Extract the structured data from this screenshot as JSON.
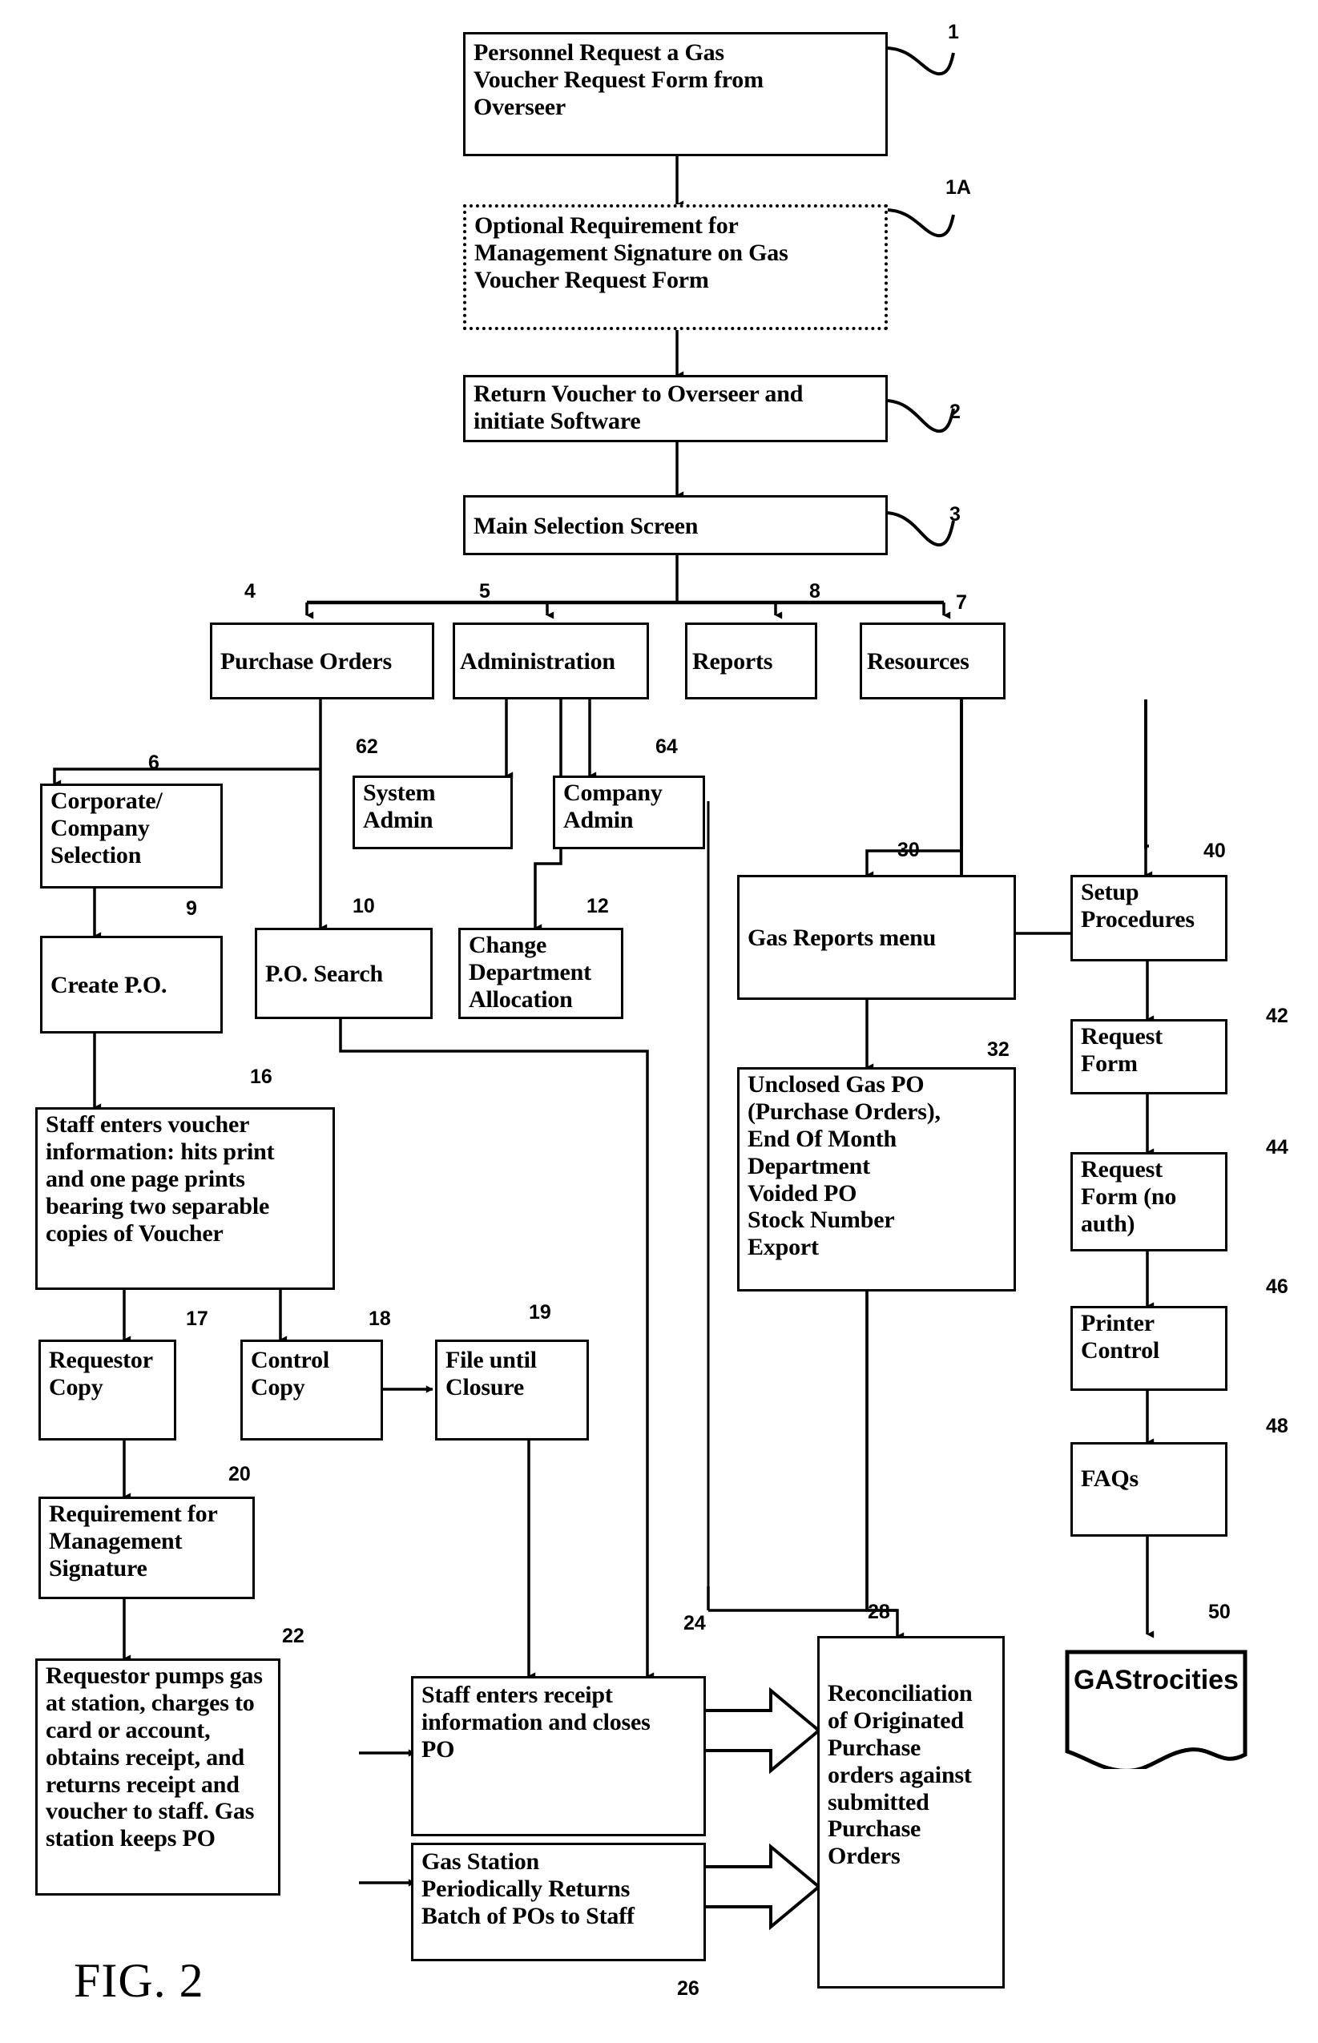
{
  "figure": {
    "label": "FIG. 2",
    "title": "Gas Voucher Purchase Order Process Flowchart"
  },
  "nodes": {
    "personnel_request": {
      "text": "Personnel Request a Gas\nVoucher Request Form from\nOverseer",
      "ref": "1"
    },
    "optional_signature": {
      "text": "Optional Requirement for\nManagement Signature on Gas\nVoucher Request Form",
      "ref": "1A"
    },
    "return_voucher": {
      "text": "Return Voucher to Overseer and\ninitiate Software",
      "ref": "2"
    },
    "main_selection": {
      "text": "Main Selection Screen",
      "ref": "3"
    },
    "purchase_orders": {
      "text": "Purchase Orders",
      "ref": "4"
    },
    "administration": {
      "text": "Administration",
      "ref": "5"
    },
    "reports": {
      "text": "Reports",
      "ref": "8"
    },
    "resources": {
      "text": "Resources",
      "ref": "7"
    },
    "system_admin": {
      "text": "System\nAdmin",
      "ref": "62"
    },
    "company_admin": {
      "text": "Company\nAdmin",
      "ref": "64"
    },
    "corporate_selection": {
      "text": "Corporate/\nCompany\nSelection",
      "ref": "6"
    },
    "create_po": {
      "text": "Create P.O.",
      "ref": "9"
    },
    "po_search": {
      "text": "P.O. Search",
      "ref": "10"
    },
    "change_dept": {
      "text": "Change\nDepartment\nAllocation",
      "ref": "12"
    },
    "gas_reports_menu": {
      "text": "Gas Reports menu",
      "ref": "30"
    },
    "unclosed_gas_po": {
      "text": "Unclosed Gas PO\n(Purchase Orders),\nEnd Of Month\nDepartment\nVoided PO\nStock Number\nExport",
      "ref": "32"
    },
    "setup_procedures": {
      "text": "Setup\nProcedures",
      "ref": "40"
    },
    "request_form": {
      "text": "Request\nForm",
      "ref": "42"
    },
    "request_form_noauth": {
      "text": "Request\nForm (no\nauth)",
      "ref": "44"
    },
    "printer_control": {
      "text": "Printer\nControl",
      "ref": "46"
    },
    "faqs": {
      "text": "FAQs",
      "ref": "48"
    },
    "gastrocities": {
      "text": "GAStrocities",
      "ref": "50"
    },
    "staff_enters_voucher": {
      "text": "Staff enters voucher\ninformation: hits print\nand one page prints\nbearing two separable\ncopies of Voucher",
      "ref": "16"
    },
    "requestor_copy": {
      "text": "Requestor\nCopy",
      "ref": "17"
    },
    "control_copy": {
      "text": "Control\nCopy",
      "ref": "18"
    },
    "file_until_closure": {
      "text": "File until\nClosure",
      "ref": "19"
    },
    "requirement_mgmt_sig": {
      "text": "Requirement for\nManagement\nSignature",
      "ref": "20"
    },
    "requestor_pumps_gas": {
      "text": "Requestor pumps gas\nat station, charges to\ncard or account,\nobtains receipt, and\nreturns receipt and\nvoucher to staff.  Gas\nstation keeps PO",
      "ref": "22"
    },
    "staff_enters_receipt": {
      "text": "Staff enters receipt\ninformation and closes\nPO",
      "ref": "24"
    },
    "gas_station_returns": {
      "text": "Gas Station\nPeriodically Returns\nBatch of POs to Staff",
      "ref": "26"
    },
    "reconciliation": {
      "text": "Reconciliation\nof Originated\nPurchase\norders against\nsubmitted\nPurchase\nOrders",
      "ref": "28"
    }
  },
  "colors": {
    "ink": "#000000",
    "paper": "#ffffff"
  }
}
